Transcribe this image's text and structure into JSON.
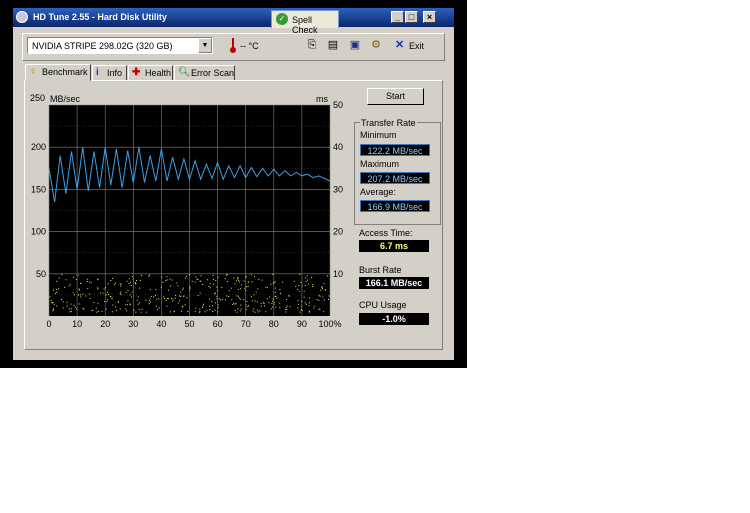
{
  "window": {
    "title": "HD Tune 2.55 - Hard Disk Utility",
    "spell_check": "Spell Check",
    "controls": [
      "minimize",
      "restore",
      "close"
    ]
  },
  "toolbar": {
    "drive_select": "NVIDIA  STRIPE   298.02G (320 GB)",
    "temperature": "-- °C",
    "exit_label": "Exit",
    "icons": [
      "copy-icon",
      "copy-text-icon",
      "save-icon",
      "options-icon",
      "exit-icon"
    ]
  },
  "tabs": [
    {
      "label": "Benchmark",
      "icon": "benchmark-icon",
      "active": true
    },
    {
      "label": "Info",
      "icon": "info-icon"
    },
    {
      "label": "Health",
      "icon": "health-icon"
    },
    {
      "label": "Error Scan",
      "icon": "search-icon"
    }
  ],
  "start_label": "Start",
  "transfer_rate": {
    "group_label": "Transfer Rate",
    "minimum_label": "Minimum",
    "minimum": "122.2 MB/sec",
    "maximum_label": "Maximum",
    "maximum": "207.2 MB/sec",
    "average_label": "Average:",
    "average": "166.9 MB/sec"
  },
  "access_time": {
    "label": "Access Time:",
    "value": "6.7 ms"
  },
  "burst_rate": {
    "label": "Burst Rate",
    "value": "166.1 MB/sec"
  },
  "cpu_usage": {
    "label": "CPU Usage",
    "value": "-1.0%"
  },
  "chart_data": {
    "type": "line",
    "ylabel_left": "MB/sec",
    "ylabel_right": "ms",
    "ylim_left": [
      0,
      250
    ],
    "ylim_right": [
      0,
      50
    ],
    "xlim": [
      0,
      100
    ],
    "left_ticks": [
      "250",
      "200",
      "150",
      "100",
      "50"
    ],
    "right_ticks": [
      "50",
      "40",
      "30",
      "20",
      "10"
    ],
    "x_ticks": [
      "0",
      "10",
      "20",
      "30",
      "40",
      "50",
      "60",
      "70",
      "80",
      "90",
      "100%"
    ],
    "grid": true,
    "colors": {
      "background": "#000000",
      "grid": "#808080",
      "transfer": "#3aa0e8",
      "access": "#e8e870"
    },
    "series": [
      {
        "kind": "transfer_rate_line",
        "x": [
          0,
          2,
          4,
          6,
          8,
          10,
          12,
          14,
          16,
          18,
          20,
          22,
          24,
          26,
          28,
          30,
          32,
          34,
          36,
          38,
          40,
          42,
          44,
          46,
          48,
          50,
          52,
          54,
          56,
          58,
          60,
          62,
          64,
          66,
          68,
          70,
          72,
          74,
          76,
          78,
          80,
          82,
          84,
          86,
          88,
          90,
          92,
          94,
          96,
          98,
          100
        ],
        "values": [
          175,
          135,
          190,
          145,
          195,
          150,
          200,
          148,
          195,
          152,
          200,
          155,
          198,
          152,
          196,
          158,
          200,
          158,
          190,
          160,
          198,
          160,
          188,
          162,
          186,
          162,
          184,
          162,
          180,
          163,
          182,
          162,
          178,
          164,
          178,
          164,
          176,
          165,
          175,
          166,
          174,
          166,
          172,
          166,
          170,
          166,
          168,
          164,
          166,
          163,
          160
        ]
      },
      {
        "kind": "access_time_scatter",
        "range_ms": [
          1,
          10
        ],
        "min_x": 0,
        "max_x": 100
      }
    ]
  }
}
